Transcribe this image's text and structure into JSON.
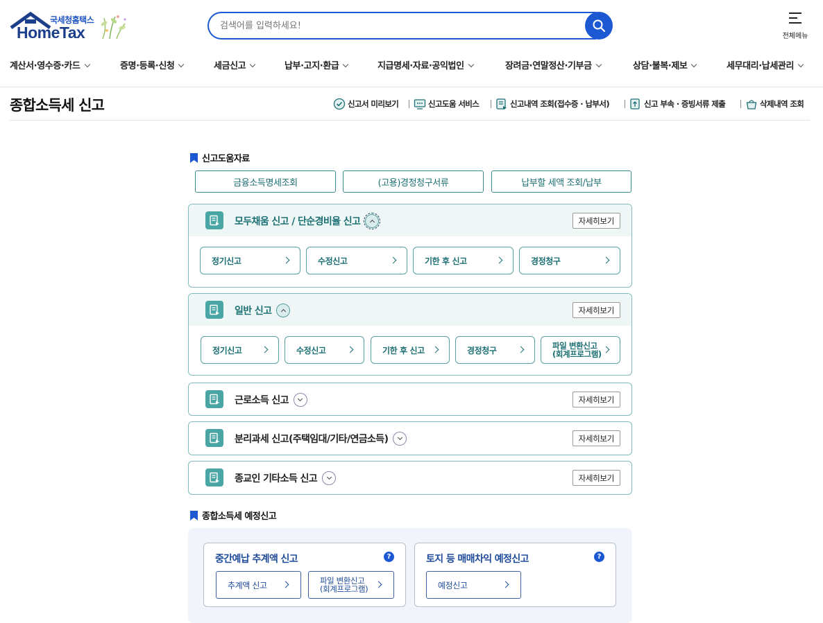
{
  "logo": {
    "sub": "국세청홈택스",
    "main": "HomeTax"
  },
  "search": {
    "placeholder": "검색어를 입력하세요!"
  },
  "allmenu": {
    "label": "전체메뉴"
  },
  "gnb": [
    "계산서·영수증·카드",
    "증명·등록·신청",
    "세금신고",
    "납부·고지·환급",
    "지급명세·자료·공익법인",
    "장려금·연말정산·기부금",
    "상담·불복·제보",
    "세무대리·납세관리"
  ],
  "page_title": "종합소득세 신고",
  "utils": [
    "신고서 미리보기",
    "신고도움 서비스",
    "신고내역 조회(접수증 · 납부서)",
    "신고 부속 · 증빙서류 제출",
    "삭제내역 조회"
  ],
  "help_section": {
    "title": "신고도움자료",
    "buttons": [
      "금융소득명세조회",
      "(고용)경정청구서류",
      "납부할 세액 조회/납부"
    ]
  },
  "panels": [
    {
      "title": "모두채움 신고 / 단순경비율 신고",
      "detail": "자세히보기",
      "actions": [
        "정기신고",
        "수정신고",
        "기한 후 신고",
        "경정청구"
      ]
    },
    {
      "title": "일반 신고",
      "detail": "자세히보기",
      "actions": [
        "정기신고",
        "수정신고",
        "기한 후 신고",
        "경정청구"
      ],
      "file_action": {
        "line1": "파일 변환신고",
        "line2": "(회계프로그램)"
      }
    },
    {
      "title": "근로소득 신고",
      "detail": "자세히보기"
    },
    {
      "title": "분리과세 신고(주택임대/기타/연금소득)",
      "detail": "자세히보기"
    },
    {
      "title": "종교인 기타소득 신고",
      "detail": "자세히보기"
    }
  ],
  "pre_section": {
    "title": "종합소득세 예정신고",
    "cards": [
      {
        "title": "중간예납 추계액 신고",
        "help": "?",
        "button": "추계액 신고",
        "file_button": {
          "line1": "파일 변환신고",
          "line2": "(회계프로그램)"
        }
      },
      {
        "title": "토지 등 매매차익 예정신고",
        "help": "?",
        "button": "예정신고"
      }
    ]
  },
  "colors": {
    "brand_blue": "#1b58d2",
    "teal": "#1c6f73",
    "panel_border": "#7fbcbb",
    "navy": "#1e4a9a"
  }
}
